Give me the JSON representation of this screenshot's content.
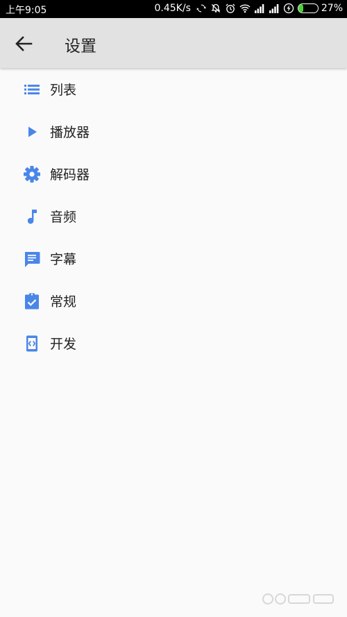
{
  "status_bar": {
    "time": "上午9:05",
    "net_speed": "0.45K/s",
    "battery_percent": "27%",
    "battery_level": 0.27,
    "icons": [
      "sync-icon",
      "alarm-off-icon",
      "alarm-icon",
      "wifi-icon",
      "signal-icon",
      "signal-icon",
      "charging-icon",
      "battery-icon"
    ]
  },
  "toolbar": {
    "back_icon": "back-arrow-icon",
    "title": "设置"
  },
  "menu": {
    "items": [
      {
        "label": "列表",
        "icon": "list-icon"
      },
      {
        "label": "播放器",
        "icon": "play-icon"
      },
      {
        "label": "解码器",
        "icon": "gear-icon"
      },
      {
        "label": "音频",
        "icon": "music-note-icon"
      },
      {
        "label": "字幕",
        "icon": "chat-bubble-icon"
      },
      {
        "label": "常规",
        "icon": "clipboard-check-icon"
      },
      {
        "label": "开发",
        "icon": "developer-mode-icon"
      }
    ]
  },
  "colors": {
    "accent": "#4a86e8",
    "toolbar_bg": "#e2e2e2",
    "page_bg": "#fafafa",
    "battery_fill": "#4cd137"
  }
}
